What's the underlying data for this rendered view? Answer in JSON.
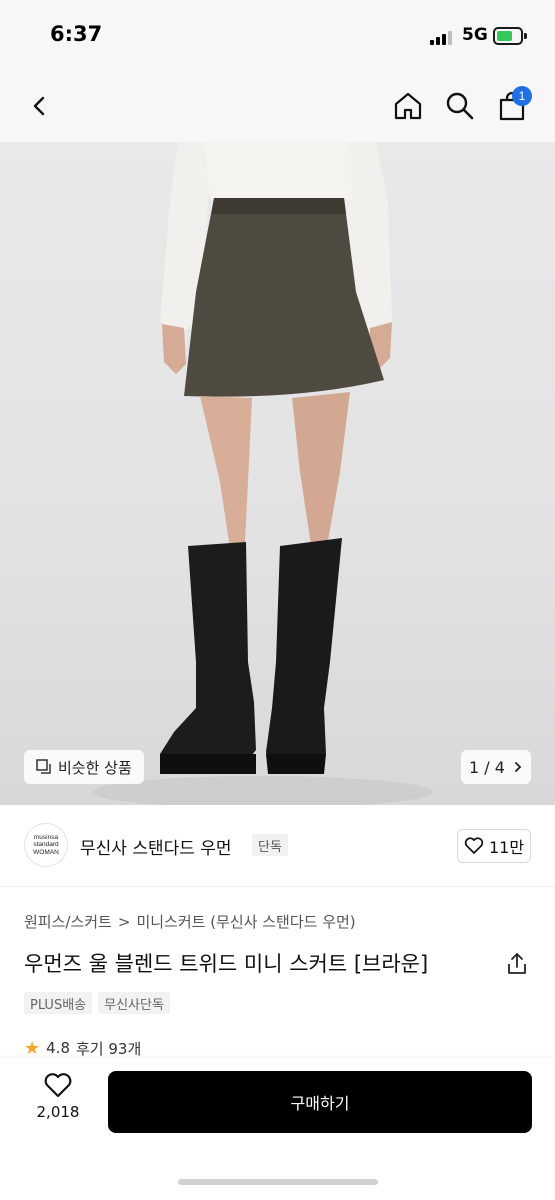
{
  "status_bar": {
    "time": "6:37",
    "network": "5G",
    "icons": [
      "signal-icon",
      "battery-icon"
    ]
  },
  "nav": {
    "icons": [
      "back-icon",
      "home-icon",
      "search-icon",
      "cart-icon"
    ],
    "cart_badge": "1",
    "accent_color": "#1f6fe5"
  },
  "gallery": {
    "similar_label": "비슷한 상품",
    "page_indicator": "1 / 4"
  },
  "brand": {
    "logo_line1": "musinsa",
    "logo_line2": "standard",
    "logo_line3": "WOMAN",
    "name": "무신사 스탠다드 우먼",
    "exclusive_tag": "단독",
    "likes": "11만"
  },
  "product": {
    "breadcrumb_category": "원피스/스커트",
    "breadcrumb_separator": ">",
    "breadcrumb_subcategory": "미니스커트 (무신사 스탠다드 우먼)",
    "title": "우먼즈 울 블렌드 트위드 미니 스커트 [브라운]",
    "tags": [
      "PLUS배송",
      "무신사단독"
    ],
    "rating": "4.8",
    "reviews": "후기 93개"
  },
  "bottom_bar": {
    "wish_count": "2,018",
    "buy_label": "구매하기"
  }
}
